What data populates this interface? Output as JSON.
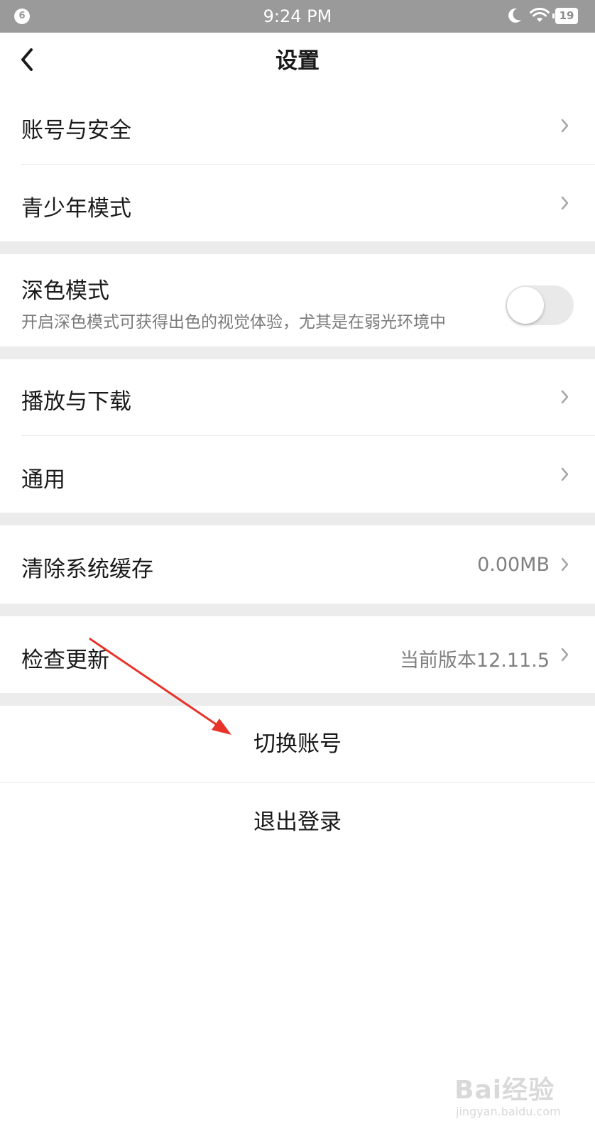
{
  "status_bar": {
    "notification_count": "6",
    "time": "9:24 PM",
    "battery": "19",
    "icons": [
      "moon-icon",
      "wifi-icon",
      "battery-icon"
    ]
  },
  "nav": {
    "title": "设置",
    "back_icon": "chevron-left-icon"
  },
  "settings": {
    "account_security": "账号与安全",
    "teen_mode": "青少年模式",
    "dark_mode": {
      "title": "深色模式",
      "subtitle": "开启深色模式可获得出色的视觉体验，尤其是在弱光环境中",
      "enabled": false
    },
    "play_download": "播放与下载",
    "general": "通用",
    "clear_cache": {
      "label": "清除系统缓存",
      "value": "0.00MB"
    },
    "check_update": {
      "label": "检查更新",
      "value": "当前版本12.11.5"
    }
  },
  "actions": {
    "switch_account": "切换账号",
    "logout": "退出登录"
  },
  "watermark": {
    "main": "Bai经验",
    "sub": "jingyan.baidu.com"
  },
  "colors": {
    "status_bar": "#9a9a9a",
    "section_gap": "#ececec",
    "annotation_arrow": "#e8332a",
    "secondary_text": "#808080"
  }
}
